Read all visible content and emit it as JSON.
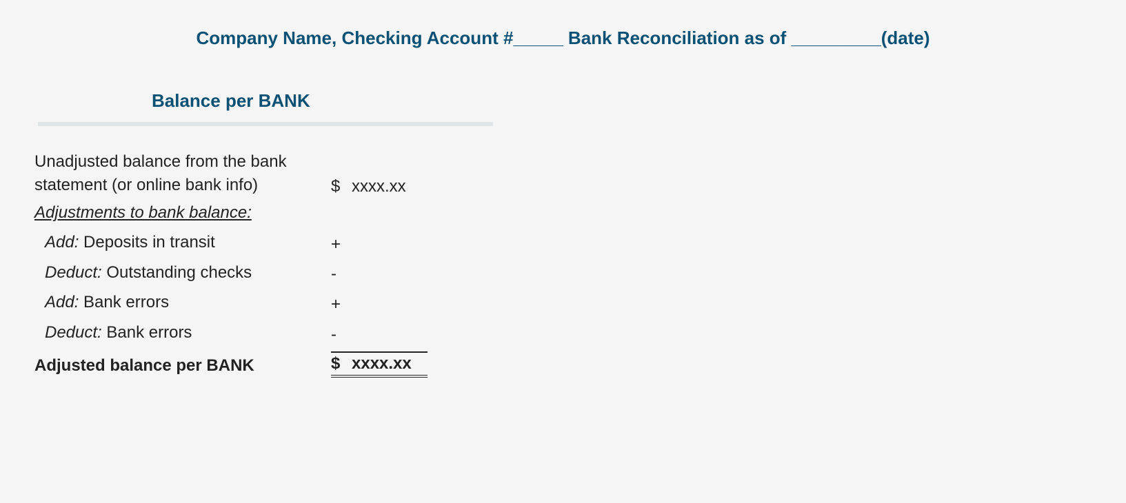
{
  "title": "Company Name, Checking Account #_____ Bank Reconciliation as of _________(date)",
  "subtitle": "Balance per BANK",
  "rows": {
    "unadjusted": {
      "label": "Unadjusted balance from the bank statement (or online bank info)",
      "sign": "$",
      "amount": "xxxx.xx"
    },
    "adjustments_header": "Adjustments to bank balance:",
    "add_deposits": {
      "prefix": "Add:",
      "label": " Deposits in transit",
      "sign": "+",
      "amount": ""
    },
    "deduct_outstanding": {
      "prefix": "Deduct:",
      "label": " Outstanding checks",
      "sign": "-",
      "amount": ""
    },
    "add_bank_errors": {
      "prefix": "Add:",
      "label": " Bank errors",
      "sign": "+",
      "amount": ""
    },
    "deduct_bank_errors": {
      "prefix": "Deduct:",
      "label": " Bank errors",
      "sign": "-",
      "amount": ""
    },
    "adjusted": {
      "label": "Adjusted balance per BANK",
      "sign": "$",
      "amount": "xxxx.xx"
    }
  }
}
